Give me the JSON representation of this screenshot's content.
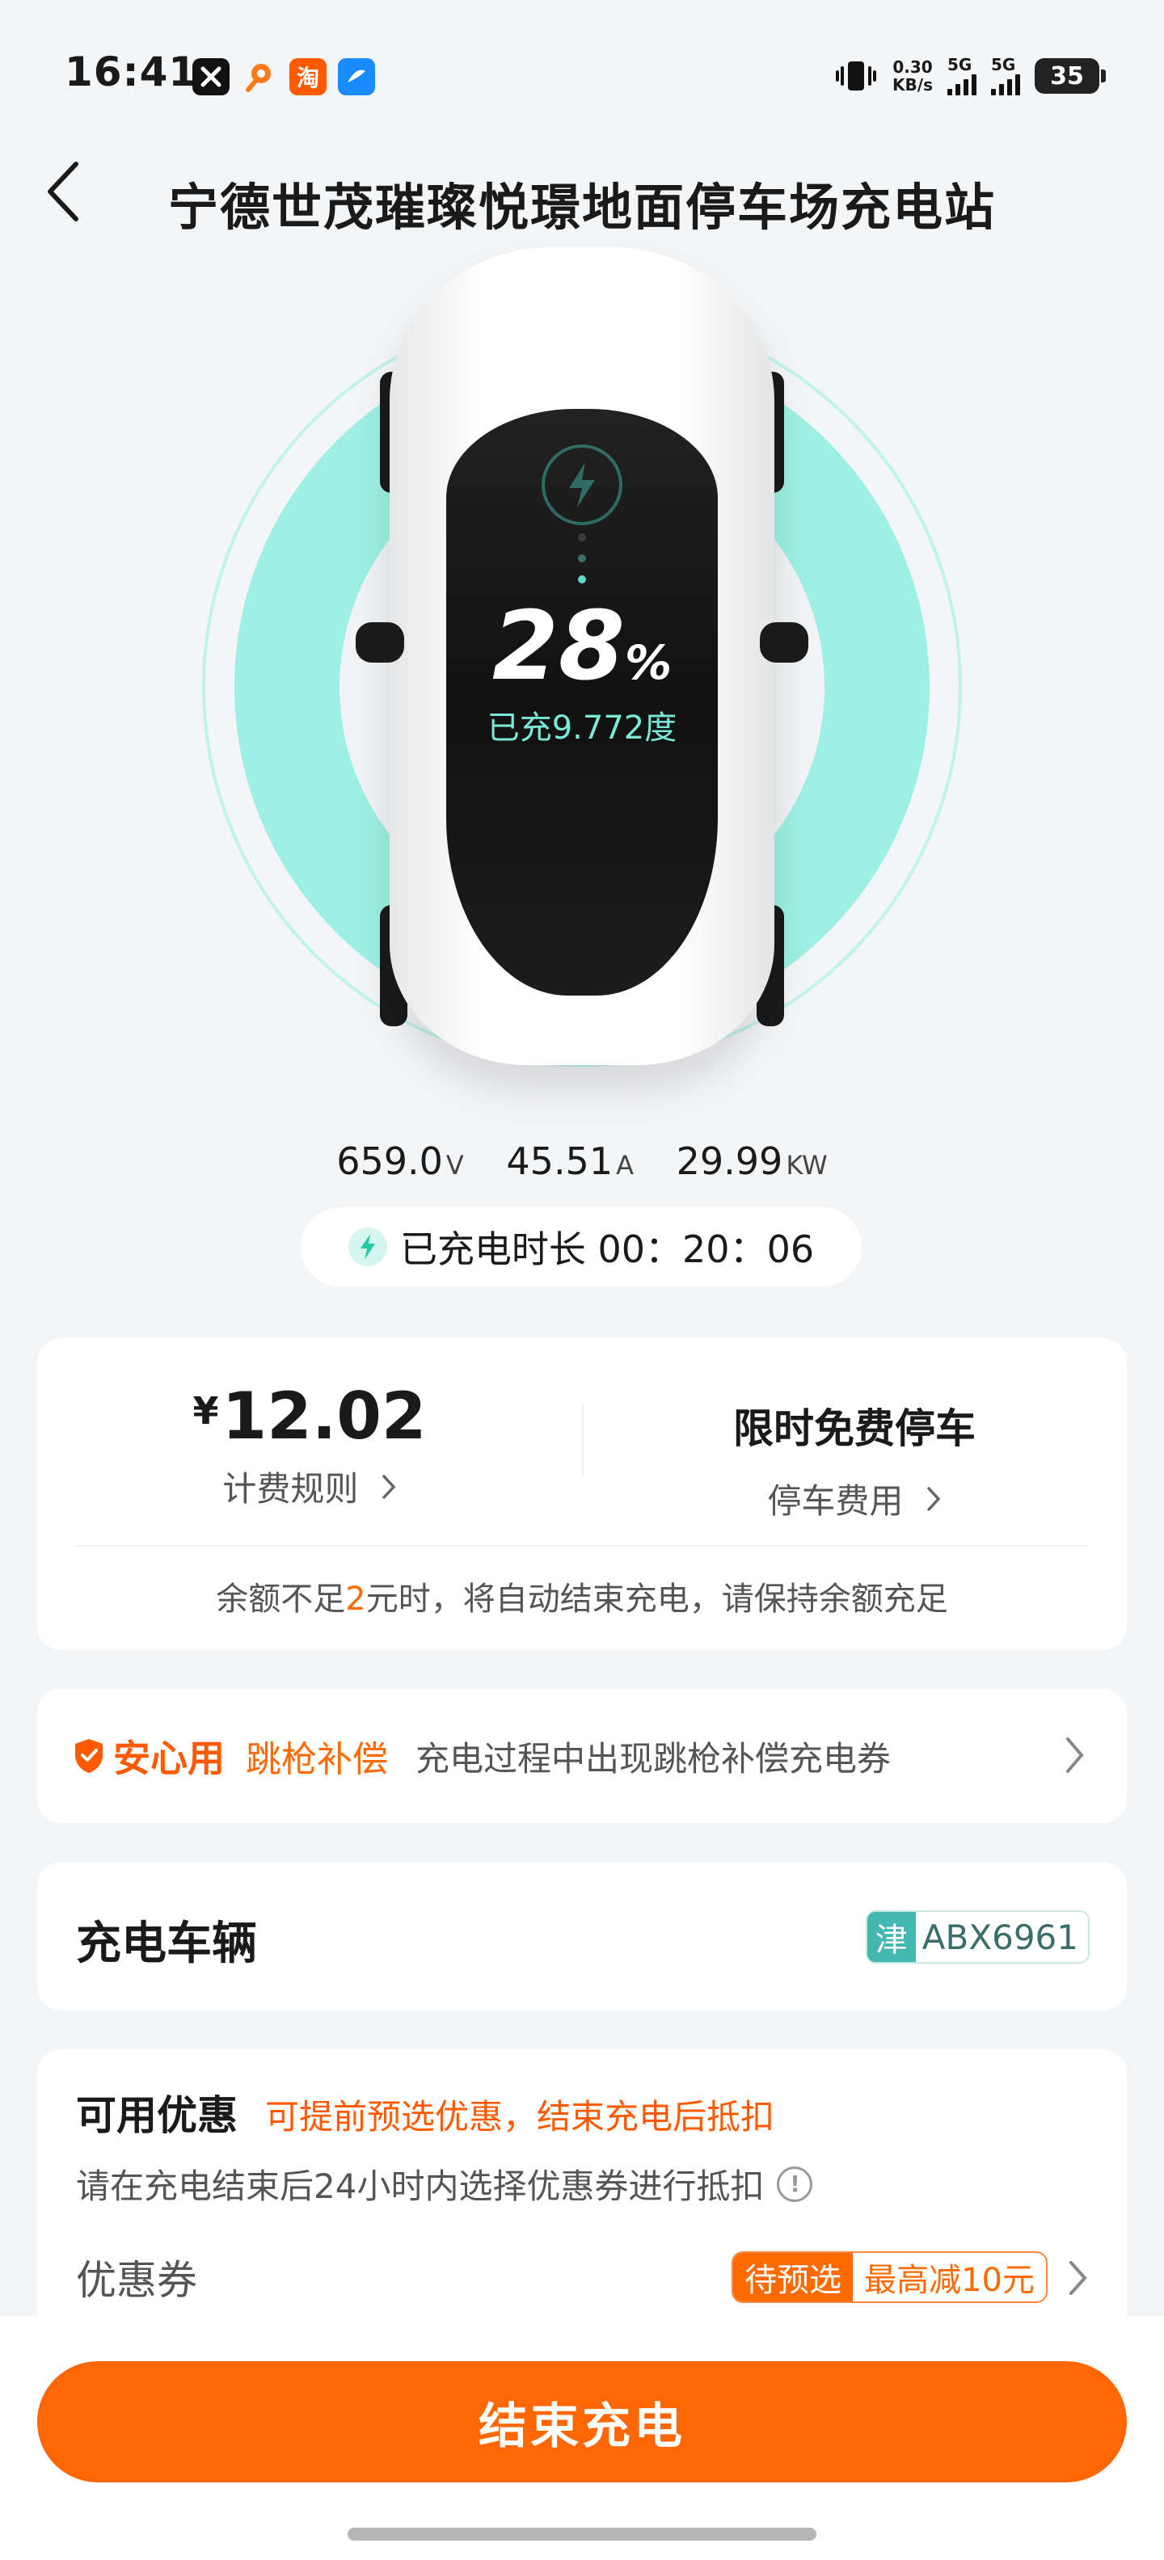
{
  "status_bar": {
    "time": "16:41",
    "app_icons": [
      "x-app-icon",
      "rocket-app-icon",
      "taobao-icon",
      "blue-app-icon"
    ],
    "taobao_char": "淘",
    "net_speed_value": "0.30",
    "net_speed_unit": "KB/s",
    "sim1": "5G",
    "sim2": "5G",
    "battery": "35"
  },
  "header": {
    "title": "宁德世茂璀璨悦璟地面停车场充电站"
  },
  "charging": {
    "percent": "28",
    "percent_symbol": "%",
    "percent_value": 28,
    "charged_text": "已充9.772度",
    "voltage": "659.0",
    "voltage_unit": "V",
    "current": "45.51",
    "current_unit": "A",
    "power": "29.99",
    "power_unit": "KW",
    "duration_label": "已充电时长 00：20：06"
  },
  "fee": {
    "currency": "¥",
    "amount": "12.02",
    "rule_link": "计费规则",
    "parking_title": "限时免费停车",
    "parking_link": "停车费用",
    "notice_prefix": "余额不足",
    "notice_highlight": "2",
    "notice_suffix": "元时，将自动结束充电，请保持余额充足"
  },
  "safe_use": {
    "brand": "安心用",
    "tag": "跳枪补偿",
    "description": "充电过程中出现跳枪补偿充电券"
  },
  "vehicle": {
    "label": "充电车辆",
    "plate_province": "津",
    "plate_number": "ABX6961"
  },
  "coupon": {
    "title": "可用优惠",
    "subtitle": "可提前预选优惠，结束充电后抵扣",
    "description": "请在充电结束后24小时内选择优惠券进行抵扣",
    "row_label": "优惠券",
    "status": "待预选",
    "max_discount": "最高减10元"
  },
  "actions": {
    "end_button": "结束充电"
  },
  "colors": {
    "accent_orange": "#ff6705",
    "teal": "#9ef0e4",
    "plate_teal": "#43b7b0"
  }
}
